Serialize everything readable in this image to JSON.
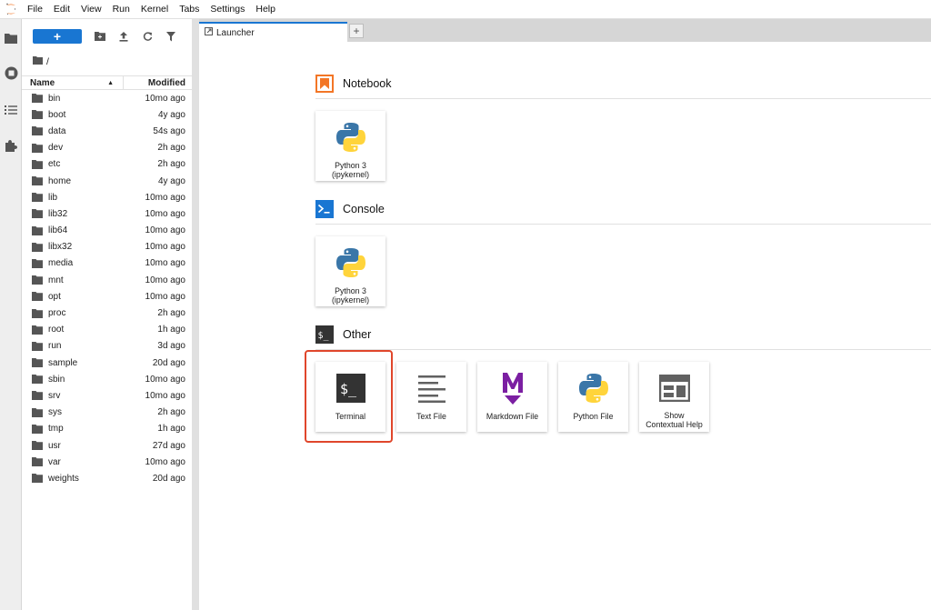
{
  "menubar": {
    "items": [
      "File",
      "Edit",
      "View",
      "Run",
      "Kernel",
      "Tabs",
      "Settings",
      "Help"
    ]
  },
  "filebrowser": {
    "new_label": "+",
    "breadcrumb": "/",
    "columns": {
      "name": "Name",
      "modified": "Modified"
    },
    "files": [
      {
        "name": "bin",
        "modified": "10mo ago"
      },
      {
        "name": "boot",
        "modified": "4y ago"
      },
      {
        "name": "data",
        "modified": "54s ago"
      },
      {
        "name": "dev",
        "modified": "2h ago"
      },
      {
        "name": "etc",
        "modified": "2h ago"
      },
      {
        "name": "home",
        "modified": "4y ago"
      },
      {
        "name": "lib",
        "modified": "10mo ago"
      },
      {
        "name": "lib32",
        "modified": "10mo ago"
      },
      {
        "name": "lib64",
        "modified": "10mo ago"
      },
      {
        "name": "libx32",
        "modified": "10mo ago"
      },
      {
        "name": "media",
        "modified": "10mo ago"
      },
      {
        "name": "mnt",
        "modified": "10mo ago"
      },
      {
        "name": "opt",
        "modified": "10mo ago"
      },
      {
        "name": "proc",
        "modified": "2h ago"
      },
      {
        "name": "root",
        "modified": "1h ago"
      },
      {
        "name": "run",
        "modified": "3d ago"
      },
      {
        "name": "sample",
        "modified": "20d ago"
      },
      {
        "name": "sbin",
        "modified": "10mo ago"
      },
      {
        "name": "srv",
        "modified": "10mo ago"
      },
      {
        "name": "sys",
        "modified": "2h ago"
      },
      {
        "name": "tmp",
        "modified": "1h ago"
      },
      {
        "name": "usr",
        "modified": "27d ago"
      },
      {
        "name": "var",
        "modified": "10mo ago"
      },
      {
        "name": "weights",
        "modified": "20d ago"
      }
    ]
  },
  "tabs": {
    "launcher_label": "Launcher",
    "add_label": "+"
  },
  "launcher": {
    "notebook": {
      "title": "Notebook",
      "cards": [
        {
          "label_line1": "Python 3",
          "label_line2": "(ipykernel)"
        }
      ]
    },
    "console": {
      "title": "Console",
      "cards": [
        {
          "label_line1": "Python 3",
          "label_line2": "(ipykernel)"
        }
      ]
    },
    "other": {
      "title": "Other",
      "cards": [
        {
          "label": "Terminal",
          "icon": "terminal-icon"
        },
        {
          "label": "Text File",
          "icon": "text-file-icon"
        },
        {
          "label": "Markdown File",
          "icon": "markdown-icon"
        },
        {
          "label": "Python File",
          "icon": "python-icon"
        },
        {
          "label_line1": "Show",
          "label_line2": "Contextual Help",
          "icon": "contextual-help-icon"
        }
      ]
    }
  },
  "colors": {
    "accent": "#1976d2",
    "notebook_icon": "#f37626",
    "console_icon": "#1976d2",
    "highlight": "#e0462b",
    "markdown": "#7b1fa2"
  }
}
